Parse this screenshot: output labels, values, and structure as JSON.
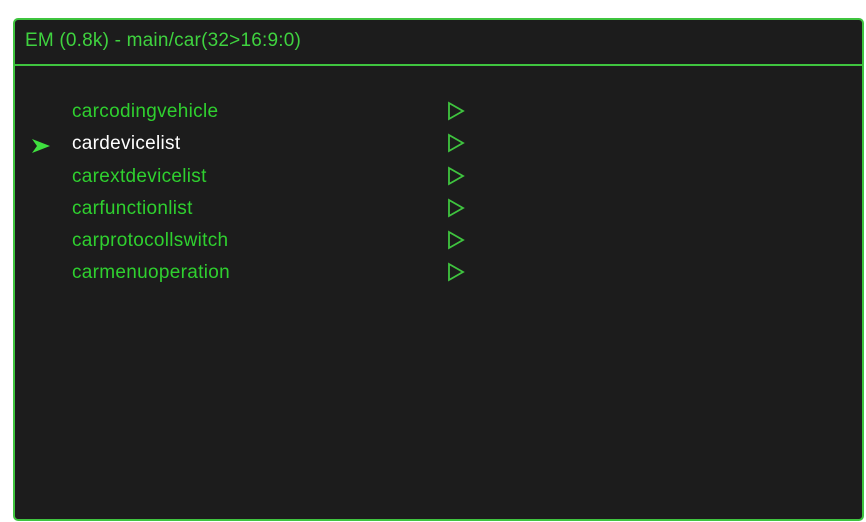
{
  "title": "EM (0.8k) - main/car(32>16:9:0)",
  "menu": {
    "selected_index": 1,
    "items": [
      {
        "label": "carcodingvehicle",
        "selected": false
      },
      {
        "label": "cardevicelist",
        "selected": true
      },
      {
        "label": "carextdevicelist",
        "selected": false
      },
      {
        "label": "carfunctionlist",
        "selected": false
      },
      {
        "label": "carprotocollswitch",
        "selected": false
      },
      {
        "label": "carmenuoperation",
        "selected": false
      }
    ]
  },
  "icons": {
    "submenu": "submenu-triangle-icon",
    "pointer": "selection-pointer-icon"
  },
  "colors": {
    "background": "#1c1c1c",
    "accent": "#3fc43f",
    "text": "#2fd02f",
    "selected_text": "#ffffff"
  }
}
